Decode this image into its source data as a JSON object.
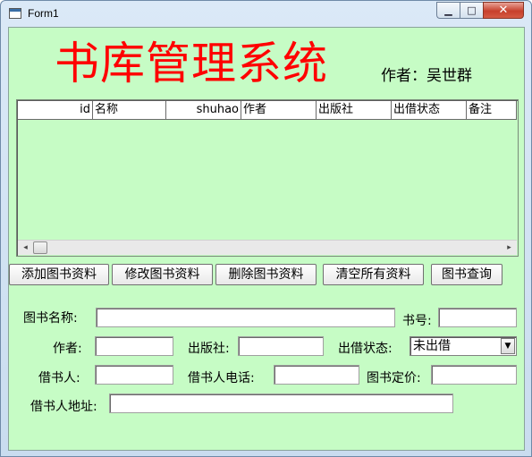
{
  "window": {
    "title": "Form1",
    "minimize_glyph": "▁",
    "maximize_glyph": "□",
    "close_glyph": "✕"
  },
  "app": {
    "title": "书库管理系统",
    "author_label": "作者：吴世群",
    "title_color": "#ff0000",
    "background_color": "#c6fcc5"
  },
  "grid": {
    "columns": [
      "id",
      "名称",
      "shuhao",
      "作者",
      "出版社",
      "出借状态",
      "备注"
    ],
    "rows": [],
    "scroll_left_glyph": "◂",
    "scroll_right_glyph": "▸"
  },
  "buttons": {
    "add": "添加图书资料",
    "edit": "修改图书资料",
    "delete": "删除图书资料",
    "clear": "清空所有资料",
    "query": "图书查询"
  },
  "form": {
    "book_name_label": "图书名称:",
    "book_name_value": "",
    "book_no_label": "书号:",
    "book_no_value": "",
    "author_label": "作者:",
    "author_value": "",
    "publisher_label": "出版社:",
    "publisher_value": "",
    "loan_status_label": "出借状态:",
    "loan_status_value": "未出借",
    "dropdown_glyph": "▼",
    "borrower_label": "借书人:",
    "borrower_value": "",
    "borrower_phone_label": "借书人电话:",
    "borrower_phone_value": "",
    "price_label": "图书定价:",
    "price_value": "",
    "borrower_address_label": "借书人地址:",
    "borrower_address_value": ""
  }
}
